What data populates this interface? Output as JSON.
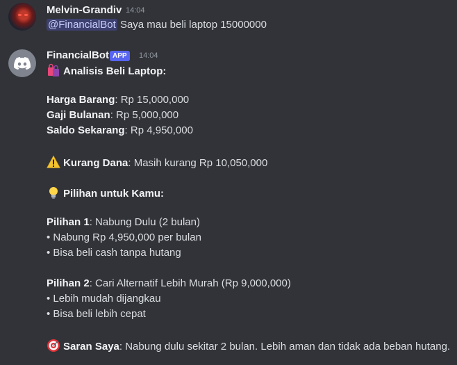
{
  "user_message": {
    "author": "Melvin-Grandiv",
    "time": "14:04",
    "mention": "@FinancialBot",
    "text": "Saya mau beli laptop 15000000"
  },
  "bot_message": {
    "author": "FinancialBot",
    "badge": "APP",
    "time": "14:04",
    "title": "Analisis Beli Laptop",
    "harga_label": "Harga Barang",
    "harga_value": ": Rp 15,000,000",
    "gaji_label": "Gaji Bulanan",
    "gaji_value": ": Rp 5,000,000",
    "saldo_label": "Saldo Sekarang",
    "saldo_value": ": Rp 4,950,000",
    "kurang_label": "Kurang Dana",
    "kurang_value": ": Masih kurang Rp 10,050,000",
    "pilihan_heading": "Pilihan untuk Kamu",
    "pilihan1_label": "Pilihan 1",
    "pilihan1_value": ": Nabung Dulu (2 bulan)",
    "pilihan1_bullets": [
      "• Nabung Rp 4,950,000 per bulan",
      "• Bisa beli cash tanpa hutang"
    ],
    "pilihan2_label": "Pilihan 2",
    "pilihan2_value": ": Cari Alternatif Lebih Murah (Rp 9,000,000)",
    "pilihan2_bullets": [
      "• Lebih mudah dijangkau",
      "• Bisa beli lebih cepat"
    ],
    "saran_label": "Saran Saya",
    "saran_value": ": Nabung dulu sekitar 2 bulan. Lebih aman dan tidak ada beban hutang."
  },
  "icons": {
    "bag": "shopping-bags-icon",
    "warning": "warning-icon",
    "bulb": "light-bulb-icon",
    "target": "target-icon"
  },
  "colors": {
    "background": "#313338",
    "badge": "#5865f2",
    "mention": "#c9cdfb"
  }
}
